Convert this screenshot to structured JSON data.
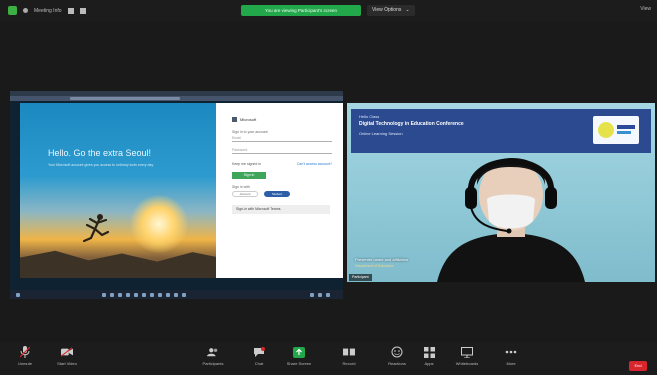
{
  "topbar": {
    "meeting_info": "Meeting Info",
    "share_banner": "You are viewing Participant's screen",
    "view_options": "View Options",
    "view_chevron": "⌄",
    "right_label": "View"
  },
  "shared_screen": {
    "heading": "Hello. Go the extra Seoul!",
    "subtext": "Your Microsoft account gives you access to ordinary tools every day.",
    "form": {
      "logo": "Microsoft",
      "title": "Sign in to your account",
      "user_placeholder": "Email",
      "pass_placeholder": "Password",
      "keep_signed": "Keep me signed in",
      "forgot": "Can't access account?",
      "signin": "Sign in",
      "option_label": "Sign in with",
      "option_a": "Account",
      "option_b": "Student",
      "link": "Sign-in with Microsoft Teams"
    }
  },
  "video": {
    "slide_t1": "Hello Class",
    "slide_t2": "Digital Technology in Education Conference",
    "slide_t3": "Online Learning Session",
    "footer1": "Presenter name and affiliation",
    "footer2": "Department of Education",
    "name_tag": "Participant"
  },
  "toolbar": {
    "items": [
      {
        "label": "Unmute"
      },
      {
        "label": "Start Video"
      },
      {
        "label": "Participants"
      },
      {
        "label": "Chat"
      },
      {
        "label": "Share Screen"
      },
      {
        "label": "Record"
      },
      {
        "label": "Reactions"
      },
      {
        "label": "Apps"
      },
      {
        "label": "Whiteboards"
      },
      {
        "label": "More"
      }
    ],
    "end": "End"
  },
  "colors": {
    "app_bg": "#1a1a1a",
    "share_green": "#22a84a",
    "end_red": "#d8262c",
    "slide_blue": "#2c4a8f"
  }
}
